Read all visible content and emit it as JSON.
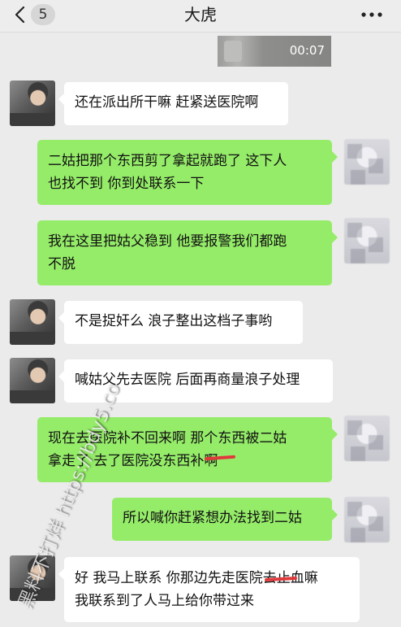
{
  "header": {
    "unread_count": "5",
    "title": "大虎",
    "back_icon": "chevron-left-icon",
    "more_icon": "more-dots-icon"
  },
  "video": {
    "duration": "00:07"
  },
  "messages": [
    {
      "side": "in",
      "text": "还在派出所干嘛 赶紧送医院啊"
    },
    {
      "side": "out",
      "text": "二姑把那个东西剪了拿起就跑了 这下人\n也找不到 你到处联系一下"
    },
    {
      "side": "out",
      "text": "我在这里把姑父稳到 他要报警我们都跑\n不脱"
    },
    {
      "side": "in",
      "text": "不是捉奸么 浪子整出这档子事哟"
    },
    {
      "side": "in",
      "text": "喊姑父先去医院 后面再商量浪子处理"
    },
    {
      "side": "out",
      "text": "现在去医院补不回来啊 那个东西被二姑\n拿走了 去了医院没东西补啊"
    },
    {
      "side": "out",
      "text": "所以喊你赶紧想办法找到二姑"
    },
    {
      "side": "in",
      "text": "好 我马上联系 你那边先走医院去止血嘛\n我联系到了人马上给你带过来"
    }
  ],
  "watermark": "黑料不打烊 https://bdy5.co",
  "colors": {
    "background": "#ebebeb",
    "outgoing_bubble": "#95ec69",
    "incoming_bubble": "#ffffff",
    "annotation_red": "#e0393b"
  }
}
